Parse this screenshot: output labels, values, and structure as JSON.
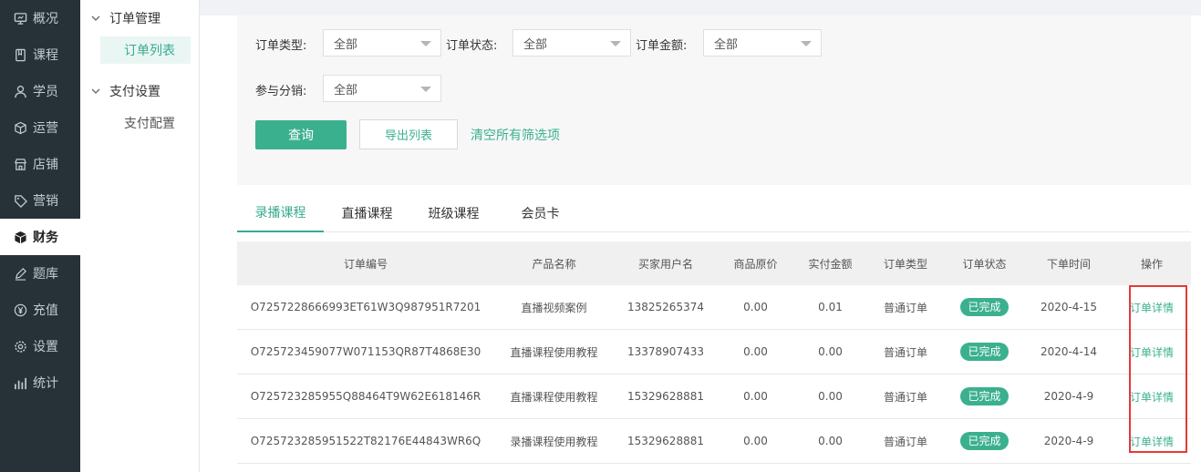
{
  "nav": {
    "items": [
      {
        "label": "概况",
        "icon": "monitor-icon",
        "active": false
      },
      {
        "label": "课程",
        "icon": "book-icon",
        "active": false
      },
      {
        "label": "学员",
        "icon": "user-icon",
        "active": false
      },
      {
        "label": "运营",
        "icon": "cube-outline-icon",
        "active": false
      },
      {
        "label": "店铺",
        "icon": "store-icon",
        "active": false
      },
      {
        "label": "营销",
        "icon": "tag-icon",
        "active": false
      },
      {
        "label": "财务",
        "icon": "cube-solid-icon",
        "active": true
      },
      {
        "label": "题库",
        "icon": "pencil-icon",
        "active": false
      },
      {
        "label": "充值",
        "icon": "yen-icon",
        "active": false
      },
      {
        "label": "设置",
        "icon": "gear-icon",
        "active": false
      },
      {
        "label": "统计",
        "icon": "bar-chart-icon",
        "active": false
      }
    ]
  },
  "subnav": {
    "group1": "订单管理",
    "item_orders": "订单列表",
    "group2": "支付设置",
    "item_pay": "支付配置"
  },
  "filters": {
    "order_type_label": "订单类型:",
    "order_type_value": "全部",
    "order_status_label": "订单状态:",
    "order_status_value": "全部",
    "order_amount_label": "订单金额:",
    "order_amount_value": "全部",
    "distribution_label": "参与分销:",
    "distribution_value": "全部",
    "query_button": "查询",
    "export_button": "导出列表",
    "clear_link": "清空所有筛选项"
  },
  "tabs": [
    "录播课程",
    "直播课程",
    "班级课程",
    "会员卡"
  ],
  "table": {
    "headers": [
      "订单编号",
      "产品名称",
      "买家用户名",
      "商品原价",
      "实付金额",
      "订单类型",
      "订单状态",
      "下单时间",
      "操作"
    ],
    "rows": [
      {
        "order_no": "O7257228666993ET61W3Q987951R7201",
        "product": "直播视频案例",
        "buyer": "13825265374",
        "original": "0.00",
        "paid": "0.01",
        "type": "普通订单",
        "status": "已完成",
        "date": "2020-4-15",
        "action": "订单详情"
      },
      {
        "order_no": "O725723459077W071153QR87T4868E30",
        "product": "直播课程使用教程",
        "buyer": "13378907433",
        "original": "0.00",
        "paid": "0.00",
        "type": "普通订单",
        "status": "已完成",
        "date": "2020-4-14",
        "action": "订单详情"
      },
      {
        "order_no": "O725723285955Q88464T9W62E618146R",
        "product": "直播课程使用教程",
        "buyer": "15329628881",
        "original": "0.00",
        "paid": "0.00",
        "type": "普通订单",
        "status": "已完成",
        "date": "2020-4-9",
        "action": "订单详情"
      },
      {
        "order_no": "O725723285951522T82176E44843WR6Q",
        "product": "录播课程使用教程",
        "buyer": "15329628881",
        "original": "0.00",
        "paid": "0.00",
        "type": "普通订单",
        "status": "已完成",
        "date": "2020-4-9",
        "action": "订单详情"
      }
    ]
  },
  "colors": {
    "accent": "#3bb08f",
    "nav_bg": "#263238",
    "highlight": "#e53935"
  }
}
